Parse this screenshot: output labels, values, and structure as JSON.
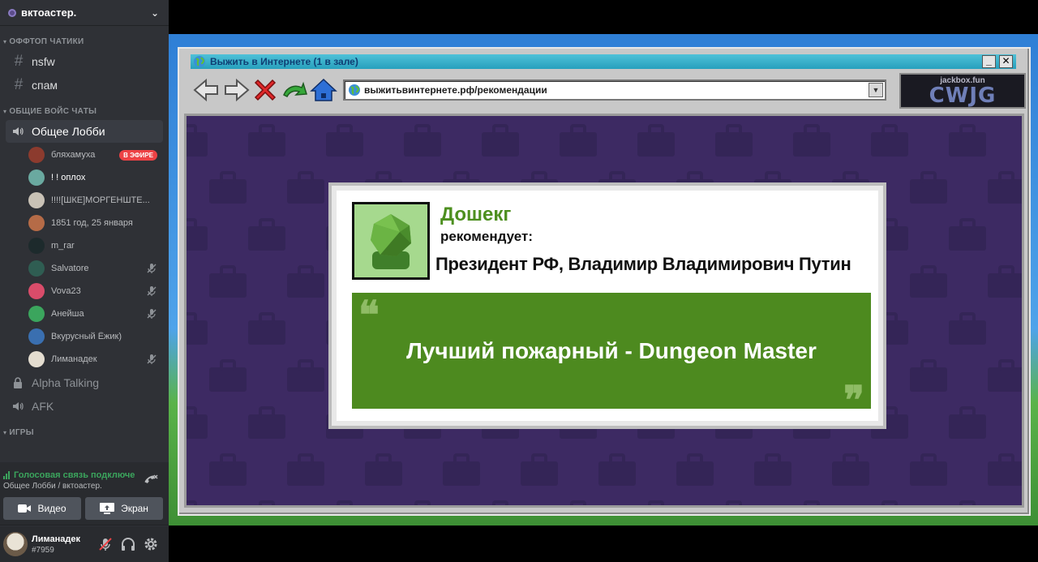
{
  "server": {
    "name": "вктоастер."
  },
  "categories": {
    "offtopic": "ОФФТОП ЧАТИКИ",
    "voice": "ОБЩИЕ ВОЙС ЧАТЫ",
    "games": "ИГРЫ"
  },
  "text_channels": [
    {
      "name": "nsfw"
    },
    {
      "name": "спам"
    }
  ],
  "voice_channels": {
    "lobby": "Общее Лобби",
    "alpha": "Alpha Talking",
    "afk": "AFK"
  },
  "voice_users": [
    {
      "name": "бляхамуха",
      "live": "В ЭФИРЕ",
      "avatar_color": "#8c3b2e",
      "muted": false
    },
    {
      "name": "! ! оплох",
      "avatar_color": "#6aa9a0",
      "muted": false
    },
    {
      "name": "!!!![ШКЕ]МОРГЕНШТЕ...",
      "avatar_color": "#c9c2b6",
      "muted": false
    },
    {
      "name": "1851 год, 25 января",
      "avatar_color": "#b56b47",
      "muted": false
    },
    {
      "name": "m_rar",
      "avatar_color": "#1d2a2c",
      "muted": false
    },
    {
      "name": "Salvatore",
      "avatar_color": "#2f5d52",
      "muted": true
    },
    {
      "name": "Vova23",
      "avatar_color": "#d94c6a",
      "muted": true
    },
    {
      "name": "Анейша",
      "avatar_color": "#3ba55d",
      "muted": true
    },
    {
      "name": "Вкурусный Ёжик)",
      "avatar_color": "#3a6fb0",
      "muted": false
    },
    {
      "name": "Лиманадек",
      "avatar_color": "#e4ddd0",
      "muted": true
    }
  ],
  "voice_panel": {
    "status": "Голосовая связь подключена",
    "location": "Общее Лобби / вктоастер.",
    "video_label": "Видео",
    "screen_label": "Экран"
  },
  "user": {
    "name": "Лиманадек",
    "tag": "#7959"
  },
  "game": {
    "window_title": "Выжить в Интернете  (1 в зале)",
    "address": "выжитьвинтернете.рф/рекомендации",
    "brand_small": "jackbox.fun",
    "brand_big": "CWJG",
    "author": "Дошекг",
    "recommends": "рекомендует:",
    "subject": "Президент РФ, Владимир Владимирович Путин",
    "quote": "Лучший пожарный - Dungeon Master",
    "quote_open_mark": "❝",
    "quote_close_mark": "❞",
    "minimize_label": "_",
    "close_label": "✕",
    "dropdown_label": "▼"
  },
  "colors": {
    "sidebar_bg": "#2f3136",
    "accent_green": "#3ba55d",
    "live_red": "#ed4245",
    "viewport_purple": "#3d2a63",
    "quote_green": "#4d8a1f",
    "title_bar": "#27a0bd"
  }
}
